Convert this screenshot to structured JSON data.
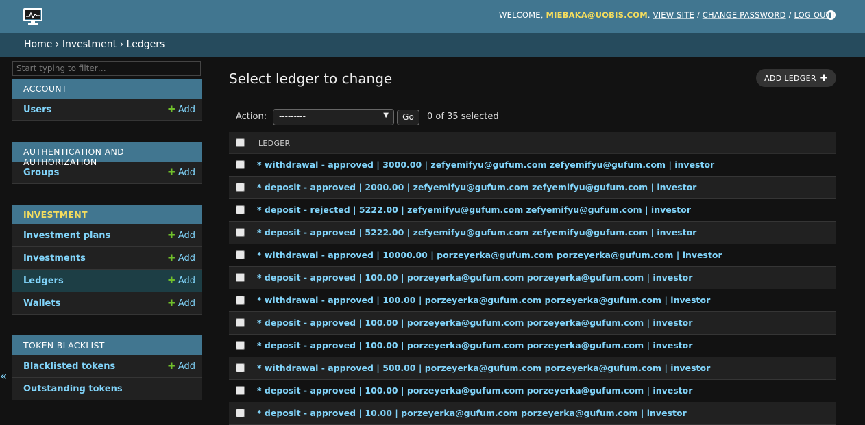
{
  "header": {
    "welcome": "WELCOME,",
    "username": "MIEBAKA@UOBIS.COM",
    "view_site": "VIEW SITE",
    "change_password": "CHANGE PASSWORD",
    "log_out": "LOG OUT",
    "separator": "/"
  },
  "breadcrumbs": {
    "home": "Home",
    "app": "Investment",
    "current": "Ledgers",
    "sep": "›"
  },
  "sidebar": {
    "filter_placeholder": "Start typing to filter…",
    "add_label": "Add",
    "modules": [
      {
        "caption": "ACCOUNT",
        "items": [
          {
            "label": "Users"
          }
        ]
      },
      {
        "caption": "AUTHENTICATION AND AUTHORIZATION",
        "items": [
          {
            "label": "Groups"
          }
        ]
      },
      {
        "caption": "INVESTMENT",
        "items": [
          {
            "label": "Investment plans"
          },
          {
            "label": "Investments"
          },
          {
            "label": "Ledgers"
          },
          {
            "label": "Wallets"
          }
        ]
      },
      {
        "caption": "TOKEN BLACKLIST",
        "items": [
          {
            "label": "Blacklisted tokens"
          },
          {
            "label": "Outstanding tokens"
          }
        ]
      }
    ],
    "collapse_icon": "«"
  },
  "content": {
    "title": "Select ledger to change",
    "add_button": "ADD LEDGER",
    "action_label": "Action:",
    "action_selected": "---------",
    "go_label": "Go",
    "selected_count": "0 of 35 selected",
    "column_header": "LEDGER",
    "rows": [
      "* withdrawal - approved | 3000.00 | zefyemifyu@gufum.com zefyemifyu@gufum.com | investor",
      "* deposit - approved | 2000.00 | zefyemifyu@gufum.com zefyemifyu@gufum.com | investor",
      "* deposit - rejected | 5222.00 | zefyemifyu@gufum.com zefyemifyu@gufum.com | investor",
      "* deposit - approved | 5222.00 | zefyemifyu@gufum.com zefyemifyu@gufum.com | investor",
      "* withdrawal - approved | 10000.00 | porzeyerka@gufum.com porzeyerka@gufum.com | investor",
      "* deposit - approved | 100.00 | porzeyerka@gufum.com porzeyerka@gufum.com | investor",
      "* withdrawal - approved | 100.00 | porzeyerka@gufum.com porzeyerka@gufum.com | investor",
      "* deposit - approved | 100.00 | porzeyerka@gufum.com porzeyerka@gufum.com | investor",
      "* deposit - approved | 100.00 | porzeyerka@gufum.com porzeyerka@gufum.com | investor",
      "* withdrawal - approved | 500.00 | porzeyerka@gufum.com porzeyerka@gufum.com | investor",
      "* deposit - approved | 100.00 | porzeyerka@gufum.com porzeyerka@gufum.com | investor",
      "* deposit - approved | 10.00 | porzeyerka@gufum.com porzeyerka@gufum.com | investor"
    ]
  },
  "colors": {
    "header_bg": "#417690",
    "breadcrumb_bg": "#264b5d",
    "link": "#81d4fa",
    "accent_yellow": "#f5dd5d",
    "add_green": "#70bf2b",
    "selected_row": "#1d3e45"
  }
}
